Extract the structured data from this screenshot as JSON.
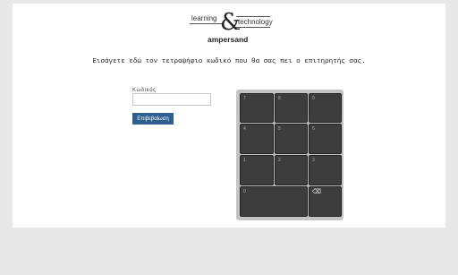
{
  "logo": {
    "word_top": "learning",
    "word_right": "technology",
    "symbol": "&",
    "brand": "ampersand"
  },
  "instruction": "Εισάγετε εδώ τον τετραψήφιο κωδικό που θα σας πει ο επιτηρητής σας.",
  "form": {
    "code_label": "Κωδικός",
    "code_value": "",
    "code_placeholder": "",
    "submit_label": "Επιβεβαίωση"
  },
  "keypad": {
    "keys": [
      "7",
      "8",
      "9",
      "4",
      "5",
      "6",
      "1",
      "2",
      "3",
      "0"
    ],
    "backspace_glyph": "⌫"
  }
}
